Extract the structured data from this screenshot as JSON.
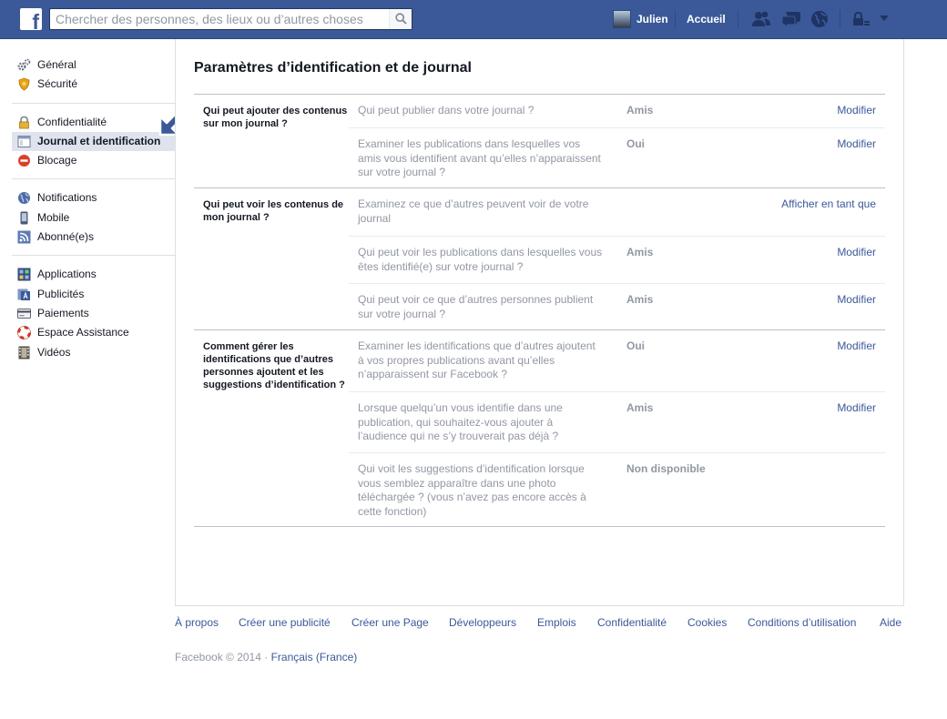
{
  "header": {
    "search_placeholder": "Chercher des personnes, des lieux ou d’autres choses",
    "user_name": "Julien",
    "home_label": "Accueil",
    "icons": [
      "friend-requests-icon",
      "messages-icon",
      "notifications-globe-icon",
      "privacy-shortcuts-icon",
      "account-menu-chevron-icon"
    ],
    "colors": {
      "bar": "#3b5998",
      "link": "#3b5998"
    }
  },
  "sidebar": {
    "groups": [
      [
        {
          "label": "Général",
          "icon": "gears-icon"
        },
        {
          "label": "Sécurité",
          "icon": "security-badge-icon"
        }
      ],
      [
        {
          "label": "Confidentialité",
          "icon": "privacy-lock-icon"
        },
        {
          "label": "Journal et identification",
          "icon": "timeline-icon",
          "active": true
        },
        {
          "label": "Blocage",
          "icon": "block-icon"
        }
      ],
      [
        {
          "label": "Notifications",
          "icon": "globe-icon"
        },
        {
          "label": "Mobile",
          "icon": "mobile-phone-icon"
        },
        {
          "label": "Abonné(e)s",
          "icon": "rss-icon"
        }
      ],
      [
        {
          "label": "Applications",
          "icon": "apps-grid-icon"
        },
        {
          "label": "Publicités",
          "icon": "ads-icon"
        },
        {
          "label": "Paiements",
          "icon": "payment-card-icon"
        },
        {
          "label": "Espace Assistance",
          "icon": "lifebuoy-icon"
        },
        {
          "label": "Vidéos",
          "icon": "film-icon"
        }
      ]
    ]
  },
  "main": {
    "title": "Paramètres d’identification et de journal",
    "sections": [
      {
        "label": "Qui peut ajouter des contenus sur mon journal ?",
        "rows": [
          {
            "question": "Qui peut publier dans votre journal ?",
            "value": "Amis",
            "action": "Modifier"
          },
          {
            "question": "Examiner les publications dans lesquelles vos amis vous identifient avant qu’elles n’apparaissent sur votre journal ?",
            "value": "Oui",
            "action": "Modifier"
          }
        ]
      },
      {
        "label": "Qui peut voir les contenus de mon journal ?",
        "rows": [
          {
            "question": "Examinez ce que d’autres peuvent voir de votre journal",
            "value": "",
            "action": "Afficher en tant que"
          },
          {
            "question": "Qui peut voir les publications dans lesquelles vous êtes identifié(e) sur votre journal ?",
            "value": "Amis",
            "action": "Modifier"
          },
          {
            "question": "Qui peut voir ce que d’autres personnes publient sur votre journal ?",
            "value": "Amis",
            "action": "Modifier"
          }
        ]
      },
      {
        "label": "Comment gérer les identifications que d’autres personnes ajoutent et les suggestions d’identification ?",
        "rows": [
          {
            "question": "Examiner les identifications que d’autres ajoutent à vos propres publications avant qu’elles n’apparaissent sur Facebook ?",
            "value": "Oui",
            "action": "Modifier"
          },
          {
            "question": "Lorsque quelqu’un vous identifie dans une publication, qui souhaitez-vous ajouter à l’audience qui ne s’y trouverait pas déjà ?",
            "value": "Amis",
            "action": "Modifier"
          },
          {
            "question": "Qui voit les suggestions d’identification lorsque vous semblez apparaître dans une photo téléchargée ? (vous n’avez pas encore accès à cette fonction)",
            "value": "Non disponible",
            "action": ""
          }
        ]
      }
    ]
  },
  "footer": {
    "links": [
      "À propos",
      "Créer une publicité",
      "Créer une Page",
      "Développeurs",
      "Emplois",
      "Confidentialité",
      "Cookies",
      "Conditions d’utilisation",
      "Aide"
    ],
    "copyright": "Facebook © 2014 ·",
    "language": "Français (France)"
  }
}
